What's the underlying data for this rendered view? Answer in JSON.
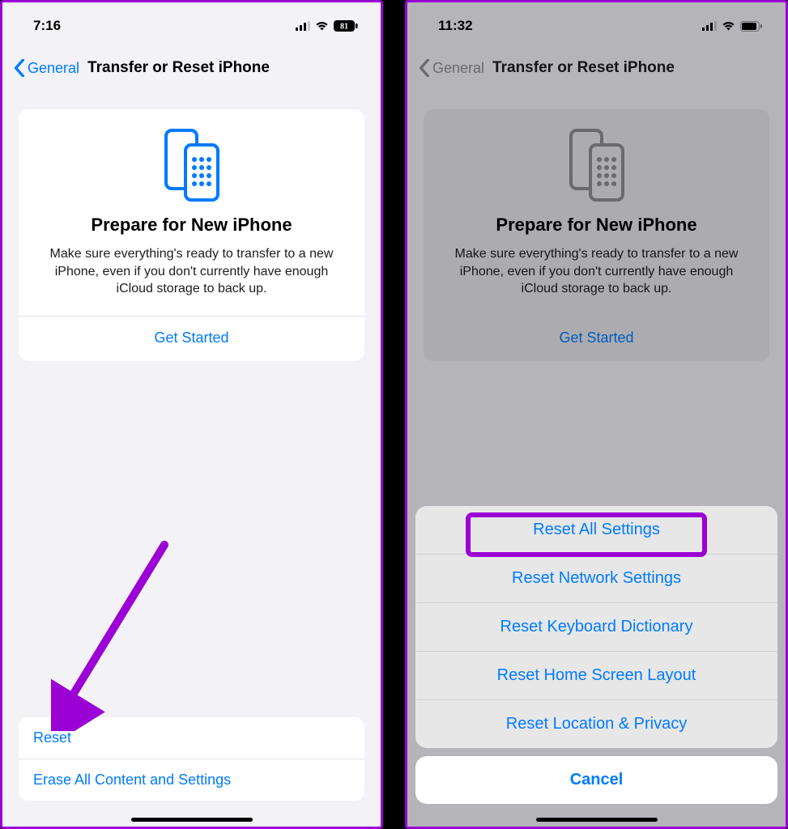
{
  "left": {
    "status": {
      "time": "7:16",
      "battery": "81"
    },
    "nav": {
      "back": "General",
      "title": "Transfer or Reset iPhone"
    },
    "card": {
      "heading": "Prepare for New iPhone",
      "body": "Make sure everything's ready to transfer to a new iPhone, even if you don't currently have enough iCloud storage to back up.",
      "cta": "Get Started"
    },
    "rows": {
      "reset": "Reset",
      "erase": "Erase All Content and Settings"
    }
  },
  "right": {
    "status": {
      "time": "11:32"
    },
    "nav": {
      "back": "General",
      "title": "Transfer or Reset iPhone"
    },
    "card": {
      "heading": "Prepare for New iPhone",
      "body": "Make sure everything's ready to transfer to a new iPhone, even if you don't currently have enough iCloud storage to back up.",
      "cta": "Get Started"
    },
    "sheet": {
      "opt1": "Reset All Settings",
      "opt2": "Reset Network Settings",
      "opt3": "Reset Keyboard Dictionary",
      "opt4": "Reset Home Screen Layout",
      "opt5": "Reset Location & Privacy",
      "cancel": "Cancel"
    }
  },
  "colors": {
    "accent": "#007aff",
    "highlight": "#9b00d4"
  }
}
